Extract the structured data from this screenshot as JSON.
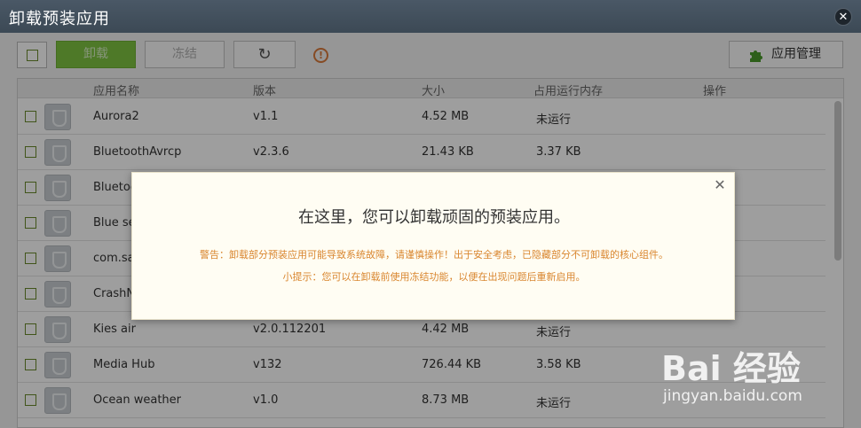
{
  "window": {
    "title": "卸载预装应用",
    "close_glyph": "✕"
  },
  "toolbar": {
    "uninstall_label": "卸载",
    "freeze_label": "冻结",
    "refresh_icon": "refresh-icon",
    "refresh_glyph": "↻",
    "warning_icon": "warning-icon",
    "warning_glyph": "!",
    "app_manager_label": "应用管理",
    "app_manager_icon": "puzzle-icon"
  },
  "table": {
    "columns": [
      "应用名称",
      "版本",
      "大小",
      "占用运行内存",
      "操作"
    ],
    "rows": [
      {
        "name": "Aurora2",
        "version": "v1.1",
        "size": "4.52 MB",
        "memory": "未运行"
      },
      {
        "name": "BluetoothAvrcp",
        "version": "v2.3.6",
        "size": "21.43 KB",
        "memory": "3.37 KB"
      },
      {
        "name": "Bluetoo",
        "version": "",
        "size": "",
        "memory": ""
      },
      {
        "name": "Blue sea",
        "version": "",
        "size": "",
        "memory": ""
      },
      {
        "name": "com.sar",
        "version": "",
        "size": "",
        "memory": ""
      },
      {
        "name": "CrashNo",
        "version": "",
        "size": "",
        "memory": ""
      },
      {
        "name": "Kies air",
        "version": "v2.0.112201",
        "size": "4.42 MB",
        "memory": "未运行"
      },
      {
        "name": "Media Hub",
        "version": "v132",
        "size": "726.44 KB",
        "memory": "3.58 KB"
      },
      {
        "name": "Ocean weather",
        "version": "v1.0",
        "size": "8.73 MB",
        "memory": "未运行"
      }
    ]
  },
  "modal": {
    "headline": "在这里，您可以卸载顽固的预装应用。",
    "warning": "警告：卸载部分预装应用可能导致系统故障，请谨慎操作！出于安全考虑，已隐藏部分不可卸载的核心组件。",
    "tip": "小提示：您可以在卸载前使用冻结功能，以便在出现问题后重新启用。",
    "close_glyph": "✕"
  },
  "watermark": {
    "main": "Bai 经验",
    "url": "jingyan.baidu.com"
  },
  "colors": {
    "accent_green": "#7fc441",
    "warning_orange": "#d9862f",
    "title_bg": "#3c4955"
  }
}
